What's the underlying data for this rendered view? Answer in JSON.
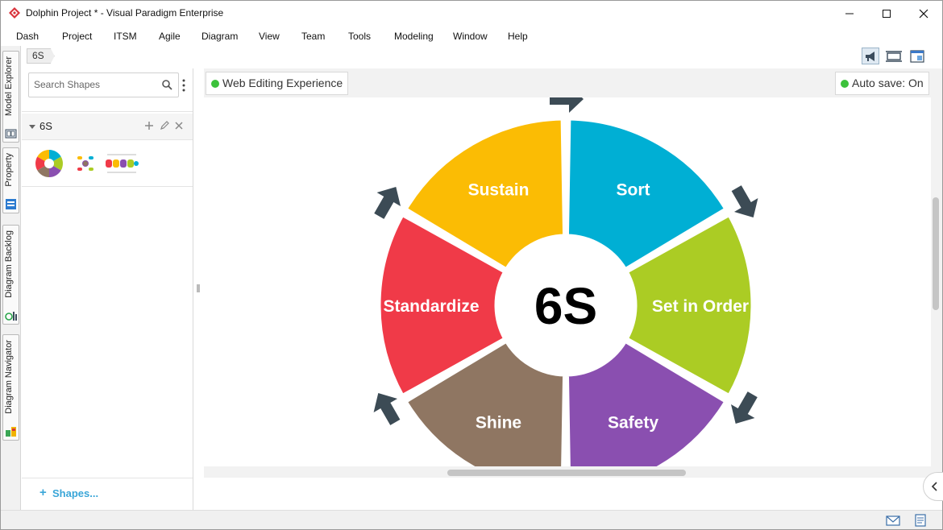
{
  "window": {
    "title": "Dolphin Project * - Visual Paradigm Enterprise",
    "icon": "visual-paradigm-logo-icon"
  },
  "menu": [
    "Dash",
    "Project",
    "ITSM",
    "Agile",
    "Diagram",
    "View",
    "Team",
    "Tools",
    "Modeling",
    "Window",
    "Help"
  ],
  "side_tabs": [
    "Model Explorer",
    "Property",
    "Diagram Backlog",
    "Diagram Navigator"
  ],
  "breadcrumb": "6S",
  "shape_panel": {
    "search_placeholder": "Search Shapes",
    "group_name": "6S",
    "footer_link": "Shapes..."
  },
  "diagram": {
    "web_editing_label": "Web Editing Experience",
    "autosave_label": "Auto save: On",
    "status_color": "#3cc13b"
  },
  "cycle": {
    "center_label": "6S",
    "segments": [
      {
        "label": "Sort",
        "color": "#00afd4"
      },
      {
        "label": "Set in Order",
        "color": "#abcc24"
      },
      {
        "label": "Safety",
        "color": "#8a4fb0"
      },
      {
        "label": "Shine",
        "color": "#8f7662"
      },
      {
        "label": "Standardize",
        "color": "#f03a48"
      },
      {
        "label": "Sustain",
        "color": "#fbbc04"
      }
    ],
    "arrow_color": "#3c4b55"
  }
}
